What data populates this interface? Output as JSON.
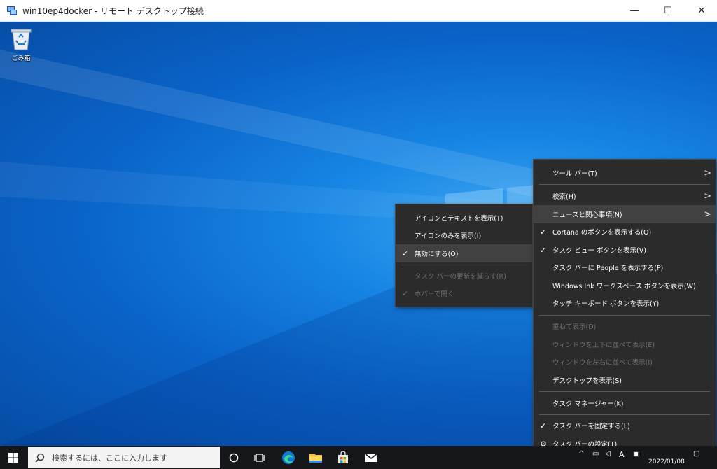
{
  "window": {
    "title": "win10ep4docker - リモート デスクトップ接続",
    "min_glyph": "—",
    "max_glyph": "☐",
    "close_glyph": "✕"
  },
  "desktop": {
    "recycle_bin_label": "ごみ箱"
  },
  "main_menu": {
    "items": [
      {
        "label": "ツール バー(T)",
        "checked": false,
        "disabled": false,
        "submenu": true
      },
      {
        "label": "検索(H)",
        "checked": false,
        "disabled": false,
        "submenu": true
      },
      {
        "label": "ニュースと関心事項(N)",
        "checked": false,
        "disabled": false,
        "submenu": true,
        "hover": true
      },
      {
        "label": "Cortana のボタンを表示する(O)",
        "checked": true,
        "disabled": false
      },
      {
        "label": "タスク ビュー ボタンを表示(V)",
        "checked": true,
        "disabled": false
      },
      {
        "label": "タスク バーに People を表示する(P)",
        "checked": false,
        "disabled": false
      },
      {
        "label": "Windows Ink ワークスペース ボタンを表示(W)",
        "checked": false,
        "disabled": false
      },
      {
        "label": "タッチ キーボード ボタンを表示(Y)",
        "checked": false,
        "disabled": false
      },
      {
        "label": "重ねて表示(D)",
        "checked": false,
        "disabled": true
      },
      {
        "label": "ウィンドウを上下に並べて表示(E)",
        "checked": false,
        "disabled": true
      },
      {
        "label": "ウィンドウを左右に並べて表示(I)",
        "checked": false,
        "disabled": true
      },
      {
        "label": "デスクトップを表示(S)",
        "checked": false,
        "disabled": false
      },
      {
        "label": "タスク マネージャー(K)",
        "checked": false,
        "disabled": false
      },
      {
        "label": "タスク バーを固定する(L)",
        "checked": true,
        "disabled": false
      },
      {
        "label": "タスク バーの設定(T)",
        "checked": false,
        "disabled": false,
        "gear": true
      }
    ]
  },
  "sub_menu": {
    "items": [
      {
        "label": "アイコンとテキストを表示(T)",
        "checked": false,
        "disabled": false
      },
      {
        "label": "アイコンのみを表示(I)",
        "checked": false,
        "disabled": false
      },
      {
        "label": "無効にする(O)",
        "checked": true,
        "disabled": false,
        "hover": true
      },
      {
        "label": "タスク バーの更新を減らす(R)",
        "checked": false,
        "disabled": true
      },
      {
        "label": "ホバーで開く",
        "checked": true,
        "disabled": true
      }
    ]
  },
  "taskbar": {
    "search_placeholder": "検索するには、ここに入力します",
    "date": "2022/01/08",
    "ime_label": "A"
  },
  "colors": {
    "menu_bg": "#2b2b2b",
    "menu_hover": "#414141",
    "taskbar_bg": "#16171b"
  }
}
